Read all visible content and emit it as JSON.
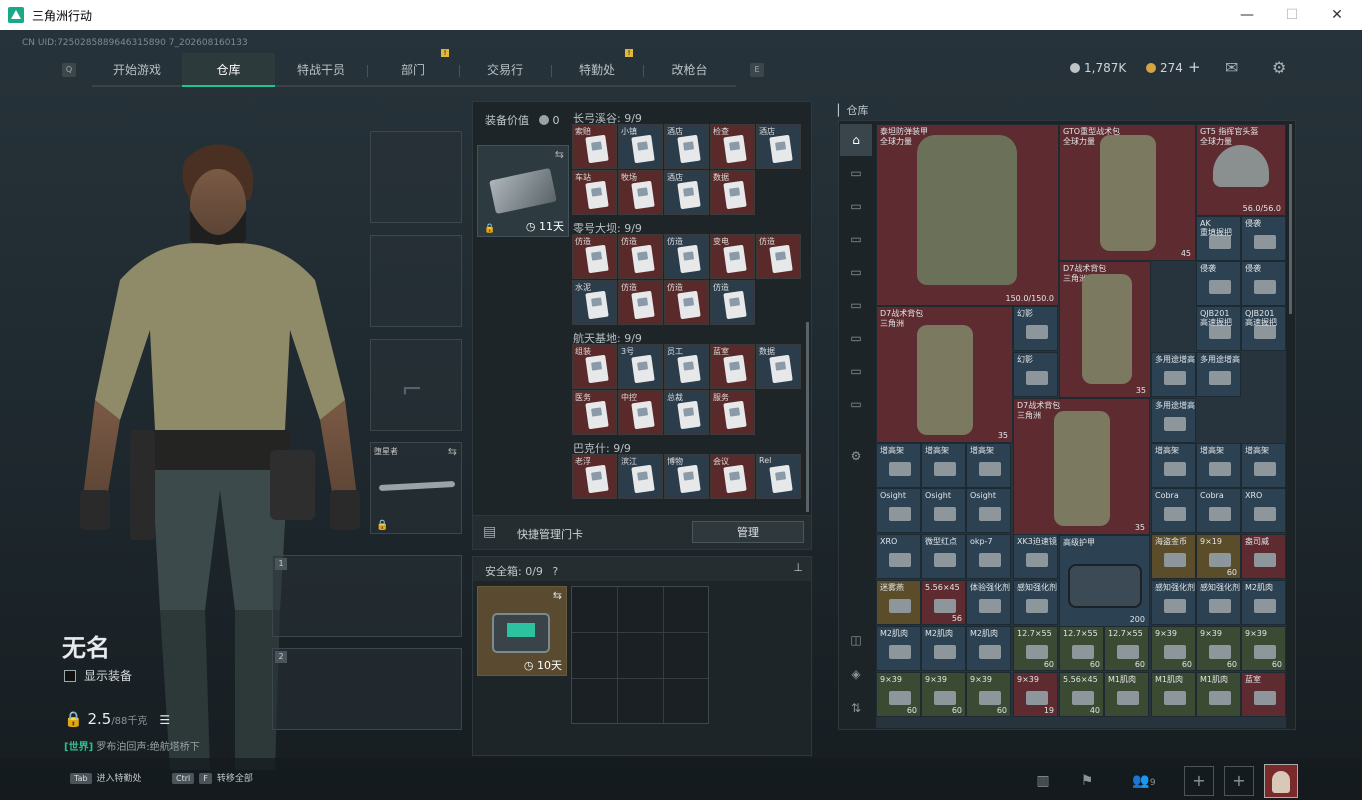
{
  "window": {
    "title": "三角洲行动",
    "minimize": "—",
    "maximize": "☐",
    "close": "✕"
  },
  "uid": "CN UID:7250285889646315890 7_202608160133",
  "nav": {
    "key_left": "Q",
    "key_right": "E",
    "tabs": [
      {
        "label": "开始游戏",
        "active": false,
        "warn": false
      },
      {
        "label": "仓库",
        "active": true,
        "warn": false
      },
      {
        "label": "特战干员",
        "active": false,
        "warn": false
      },
      {
        "label": "部门",
        "active": false,
        "warn": true
      },
      {
        "label": "交易行",
        "active": false,
        "warn": false
      },
      {
        "label": "特勤处",
        "active": false,
        "warn": true
      },
      {
        "label": "改枪台",
        "active": false,
        "warn": false
      }
    ],
    "warn_mark": "!"
  },
  "currency": {
    "silver": "1,787K",
    "gold": "274",
    "add": "+"
  },
  "character": {
    "name": "无名",
    "show_equipment": "显示装备",
    "weight": "2.5",
    "weight_max": "/88千克",
    "channel_tag": "[世界]",
    "channel_text": "罗布泊回声:绝航塔桥下"
  },
  "loadout": {
    "melee_label": "堕星者",
    "slot1": "1",
    "slot2": "2"
  },
  "equipment_value": {
    "label": "装备价值",
    "value": "0"
  },
  "keycase": {
    "timer": "11天",
    "swap": "⇆"
  },
  "keycard_sections": [
    {
      "title": "长弓溪谷: 9/9",
      "labels": [
        "索赔",
        "小镇",
        "酒店",
        "检查",
        "酒店",
        "车站",
        "牧场",
        "酒店",
        "数据"
      ]
    },
    {
      "title": "零号大坝: 9/9",
      "labels": [
        "仿造",
        "仿造",
        "仿造",
        "变电",
        "仿造",
        "水泥",
        "仿造",
        "仿造",
        "仿造"
      ]
    },
    {
      "title": "航天基地: 9/9",
      "labels": [
        "组装",
        "3号",
        "员工",
        "蓝室",
        "数据",
        "医务",
        "中控",
        "总裁",
        "服务"
      ]
    },
    {
      "title": "巴克什: 9/9",
      "labels": [
        "老浮",
        "滨江",
        "博物",
        "会议",
        "Rel"
      ]
    }
  ],
  "quick_manage": {
    "label": "快捷管理门卡",
    "button": "管理"
  },
  "safebox": {
    "label": "安全箱:",
    "count": "0/9",
    "help": "?",
    "timer": "10天",
    "pin": "📌"
  },
  "warehouse": {
    "label": "仓库"
  },
  "inventory": {
    "big_items": [
      {
        "label": "泰坦防弹装甲\n全球力量",
        "value": "150.0/150.0"
      },
      {
        "label": "GTO重型战术包\n全球力量",
        "value": "45"
      },
      {
        "label": "GT5 指挥官头盔\n全球力量",
        "value": "56.0/56.0"
      },
      {
        "label": "D7战术背包\n三角洲",
        "value": "35"
      },
      {
        "label": "D7战术背包\n三角洲",
        "value": "35"
      },
      {
        "label": "D7战术背包\n三角洲",
        "value": "35"
      },
      {
        "label": "高级护甲",
        "value": "200"
      }
    ],
    "cells": [
      {
        "label": "AK\n重填握把",
        "num": ""
      },
      {
        "label": "侵袭",
        "num": ""
      },
      {
        "label": "侵袭",
        "num": ""
      },
      {
        "label": "侵袭",
        "num": ""
      },
      {
        "label": "幻影",
        "num": ""
      },
      {
        "label": "QJB201\n高速握把",
        "num": ""
      },
      {
        "label": "QJB201\n高速握把",
        "num": ""
      },
      {
        "label": "幻影",
        "num": ""
      },
      {
        "label": "多用途增高",
        "num": ""
      },
      {
        "label": "多用途增高",
        "num": ""
      },
      {
        "label": "多用途增高",
        "num": ""
      },
      {
        "label": "增高架",
        "num": ""
      },
      {
        "label": "增高架",
        "num": ""
      },
      {
        "label": "增高架",
        "num": ""
      },
      {
        "label": "增高架",
        "num": ""
      },
      {
        "label": "增高架",
        "num": ""
      },
      {
        "label": "增高架",
        "num": ""
      },
      {
        "label": "增高架",
        "num": ""
      },
      {
        "label": "Osight",
        "num": ""
      },
      {
        "label": "Osight",
        "num": ""
      },
      {
        "label": "Osight",
        "num": ""
      },
      {
        "label": "Osight",
        "num": ""
      },
      {
        "label": "Cobra",
        "num": ""
      },
      {
        "label": "Cobra",
        "num": ""
      },
      {
        "label": "XRO",
        "num": ""
      },
      {
        "label": "XRO",
        "num": ""
      },
      {
        "label": "微型红点",
        "num": ""
      },
      {
        "label": "okp-7",
        "num": ""
      },
      {
        "label": "XK3迫速镜",
        "num": ""
      },
      {
        "label": "海盗金币",
        "num": ""
      },
      {
        "label": "9×19",
        "num": "60"
      },
      {
        "label": "盎司威",
        "num": ""
      },
      {
        "label": "迷雾燕",
        "num": ""
      },
      {
        "label": "5.56×45",
        "num": "56"
      },
      {
        "label": "体验强化剂",
        "num": ""
      },
      {
        "label": "感知强化剂",
        "num": ""
      },
      {
        "label": "感知强化剂",
        "num": ""
      },
      {
        "label": "感知强化剂",
        "num": ""
      },
      {
        "label": "M2肌肉",
        "num": ""
      },
      {
        "label": "M2肌肉",
        "num": ""
      },
      {
        "label": "M2肌肉",
        "num": ""
      },
      {
        "label": "M2肌肉",
        "num": ""
      },
      {
        "label": "12.7×55",
        "num": "60"
      },
      {
        "label": "12.7×55",
        "num": "60"
      },
      {
        "label": "12.7×55",
        "num": "60"
      },
      {
        "label": "9×39",
        "num": "60"
      },
      {
        "label": "9×39",
        "num": "60"
      },
      {
        "label": "9×39",
        "num": "60"
      },
      {
        "label": "9×39",
        "num": "60"
      },
      {
        "label": "9×39",
        "num": "60"
      },
      {
        "label": "9×39",
        "num": "60"
      },
      {
        "label": "9×39",
        "num": "19"
      },
      {
        "label": "5.56×45",
        "num": "40"
      },
      {
        "label": "M1肌肉",
        "num": ""
      },
      {
        "label": "M1肌肉",
        "num": ""
      },
      {
        "label": "M1肌肉",
        "num": ""
      },
      {
        "label": "蓝室",
        "num": ""
      }
    ]
  },
  "bottom": {
    "tab_key": "Tab",
    "tab_label": "进入特勤处",
    "ctrl_key": "Ctrl",
    "f_key": "F",
    "transfer_label": "转移全部",
    "squad_count": "9"
  }
}
